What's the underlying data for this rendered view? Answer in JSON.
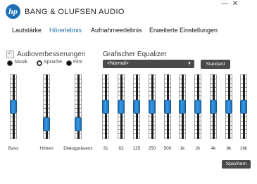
{
  "header": {
    "logo_text": "hp",
    "brand": "BANG & OLUFSEN AUDIO",
    "minimize_label": "—",
    "close_label": "✕"
  },
  "tabs": [
    {
      "label": "Lautstärke",
      "active": false
    },
    {
      "label": "Hörerlebnis",
      "active": true
    },
    {
      "label": "Aufnahmeerlebnis",
      "active": false
    },
    {
      "label": "Erweiterte Einstellungen",
      "active": false
    }
  ],
  "enhancements": {
    "checkbox_label": "Audioverbesserungen",
    "checked": true,
    "modes": [
      {
        "label": "Musik",
        "selected": false
      },
      {
        "label": "Sprache",
        "selected": true
      },
      {
        "label": "Film",
        "selected": false
      }
    ]
  },
  "left_sliders": [
    {
      "label": "Bass",
      "level": 0.5
    },
    {
      "label": "Höhen",
      "level": 0.15
    },
    {
      "label": "Dialogpräsenz",
      "level": 0.15
    }
  ],
  "equalizer": {
    "title": "Grafischer Equalizer",
    "preset": "<Normal>",
    "standard_button": "Standard",
    "bands": [
      {
        "label": "31",
        "level": 0.5
      },
      {
        "label": "62",
        "level": 0.5
      },
      {
        "label": "125",
        "level": 0.5
      },
      {
        "label": "250",
        "level": 0.5
      },
      {
        "label": "500",
        "level": 0.5
      },
      {
        "label": "1k",
        "level": 0.5
      },
      {
        "label": "2k",
        "level": 0.5
      },
      {
        "label": "4k",
        "level": 0.5
      },
      {
        "label": "8k",
        "level": 0.5
      },
      {
        "label": "16k",
        "level": 0.5
      }
    ]
  },
  "save_button": "Speichern",
  "colors": {
    "accent": "#1f6fb5",
    "button_bg": "#4a4a4a"
  }
}
